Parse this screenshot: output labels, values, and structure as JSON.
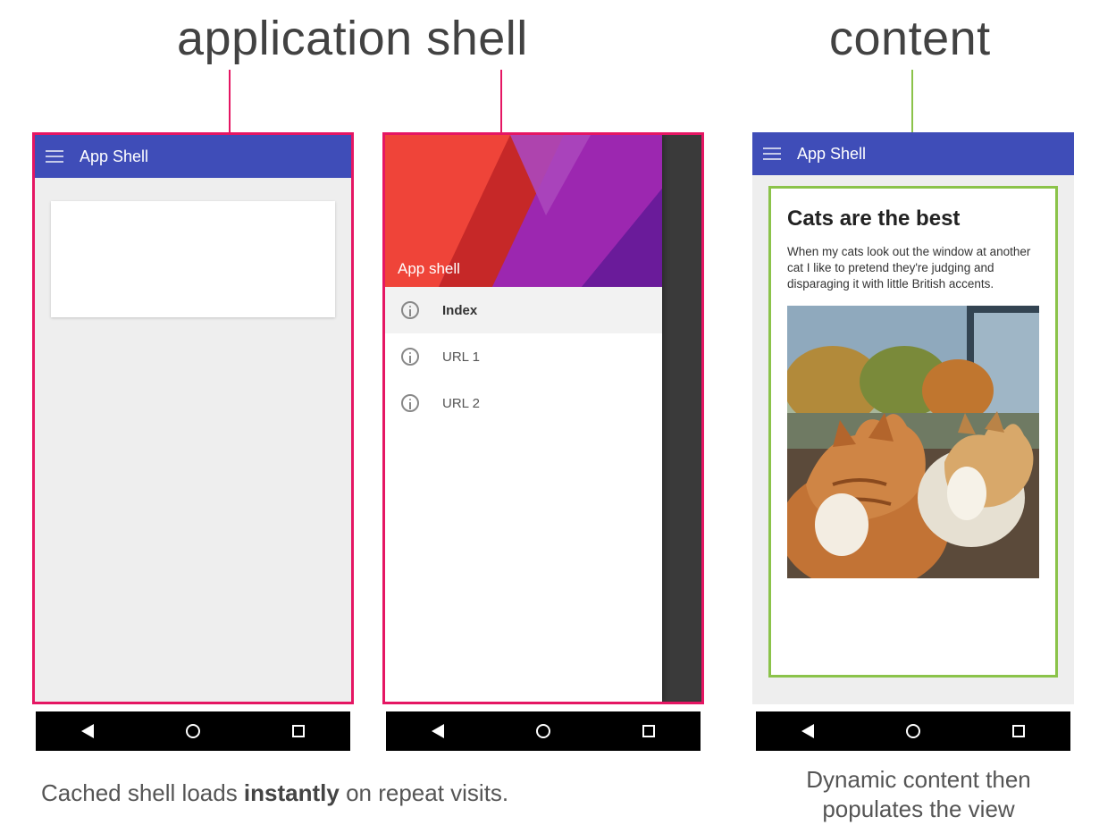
{
  "headings": {
    "shell": "application shell",
    "content": "content"
  },
  "colors": {
    "appbar": "#3f4db8",
    "highlight_pink": "#e51663",
    "highlight_green": "#8bc34a"
  },
  "phone1": {
    "appbar_title": "App Shell"
  },
  "phone2": {
    "drawer_title": "App shell",
    "items": [
      {
        "label": "Index",
        "active": true
      },
      {
        "label": "URL 1",
        "active": false
      },
      {
        "label": "URL 2",
        "active": false
      }
    ]
  },
  "phone3": {
    "appbar_title": "App Shell",
    "article_title": "Cats are the best",
    "article_body": "When my cats look out the window at another cat I like to pretend they're judging and disparaging it with little British accents."
  },
  "captions": {
    "left_a": "Cached shell loads ",
    "left_b": "instantly",
    "left_c": " on repeat visits.",
    "right": "Dynamic content then populates the view"
  }
}
